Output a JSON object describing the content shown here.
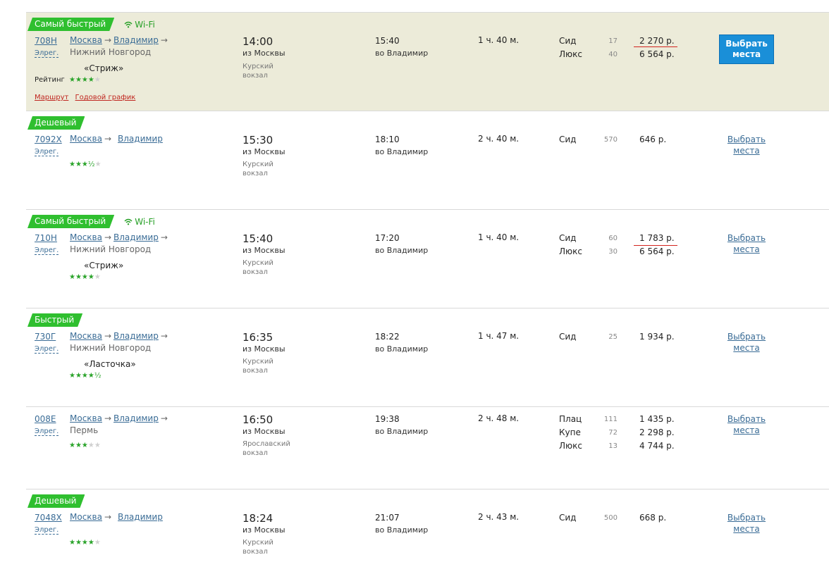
{
  "wifi_label": "Wi-Fi",
  "rating_label": "Рейтинг",
  "select_button_label": "Выбрать места",
  "select_link_line1": "Выбрать",
  "select_link_line2": "места",
  "route_link_label": "Маршрут",
  "schedule_link_label": "Годовой график",
  "trains": [
    {
      "badge": "Самый быстрый",
      "wifi": true,
      "number": "708Н",
      "type": "Элрег.",
      "from": "Москва",
      "to": "Владимир",
      "dest": "Нижний Новгород",
      "name": "«Стриж»",
      "rating": 4,
      "dep_time": "14:00",
      "dep_label": "из Москвы",
      "station": "Курский вокзал",
      "arr_time": "15:40",
      "arr_label": "во Владимир",
      "duration": "1 ч. 40 м.",
      "classes": [
        {
          "name": "Сид",
          "seats": "17",
          "price": "2 270 р."
        },
        {
          "name": "Люкс",
          "seats": "40",
          "price": "6 564 р."
        }
      ]
    },
    {
      "badge": "Дешевый",
      "wifi": false,
      "number": "7092Х",
      "type": "Элрег.",
      "from": "Москва",
      "to": "Владимир",
      "dest": "",
      "name": "",
      "rating": 3.5,
      "dep_time": "15:30",
      "dep_label": "из Москвы",
      "station": "Курский вокзал",
      "arr_time": "18:10",
      "arr_label": "во Владимир",
      "duration": "2 ч. 40 м.",
      "classes": [
        {
          "name": "Сид",
          "seats": "570",
          "price": "646 р."
        }
      ]
    },
    {
      "badge": "Самый быстрый",
      "wifi": true,
      "number": "710Н",
      "type": "Элрег.",
      "from": "Москва",
      "to": "Владимир",
      "dest": "Нижний Новгород",
      "name": "«Стриж»",
      "rating": 4,
      "dep_time": "15:40",
      "dep_label": "из Москвы",
      "station": "Курский вокзал",
      "arr_time": "17:20",
      "arr_label": "во Владимир",
      "duration": "1 ч. 40 м.",
      "classes": [
        {
          "name": "Сид",
          "seats": "60",
          "price": "1 783 р."
        },
        {
          "name": "Люкс",
          "seats": "30",
          "price": "6 564 р."
        }
      ]
    },
    {
      "badge": "Быстрый",
      "wifi": false,
      "number": "730Г",
      "type": "Элрег.",
      "from": "Москва",
      "to": "Владимир",
      "dest": "Нижний Новгород",
      "name": "«Ласточка»",
      "rating": 4.5,
      "dep_time": "16:35",
      "dep_label": "из Москвы",
      "station": "Курский вокзал",
      "arr_time": "18:22",
      "arr_label": "во Владимир",
      "duration": "1 ч. 47 м.",
      "classes": [
        {
          "name": "Сид",
          "seats": "25",
          "price": "1 934 р."
        }
      ]
    },
    {
      "badge": "",
      "wifi": false,
      "number": "008Е",
      "type": "Элрег.",
      "from": "Москва",
      "to": "Владимир",
      "dest": "Пермь",
      "name": "",
      "rating": 3,
      "dep_time": "16:50",
      "dep_label": "из Москвы",
      "station": "Ярославский вокзал",
      "arr_time": "19:38",
      "arr_label": "во Владимир",
      "duration": "2 ч. 48 м.",
      "classes": [
        {
          "name": "Плац",
          "seats": "111",
          "price": "1 435 р."
        },
        {
          "name": "Купе",
          "seats": "72",
          "price": "2 298 р."
        },
        {
          "name": "Люкс",
          "seats": "13",
          "price": "4 744 р."
        }
      ]
    },
    {
      "badge": "Дешевый",
      "wifi": false,
      "number": "7048Х",
      "type": "Элрег.",
      "from": "Москва",
      "to": "Владимир",
      "dest": "",
      "name": "",
      "rating": 4,
      "dep_time": "18:24",
      "dep_label": "из Москвы",
      "station": "Курский вокзал",
      "arr_time": "21:07",
      "arr_label": "во Владимир",
      "duration": "2 ч. 43 м.",
      "classes": [
        {
          "name": "Сид",
          "seats": "500",
          "price": "668 р."
        }
      ]
    }
  ]
}
